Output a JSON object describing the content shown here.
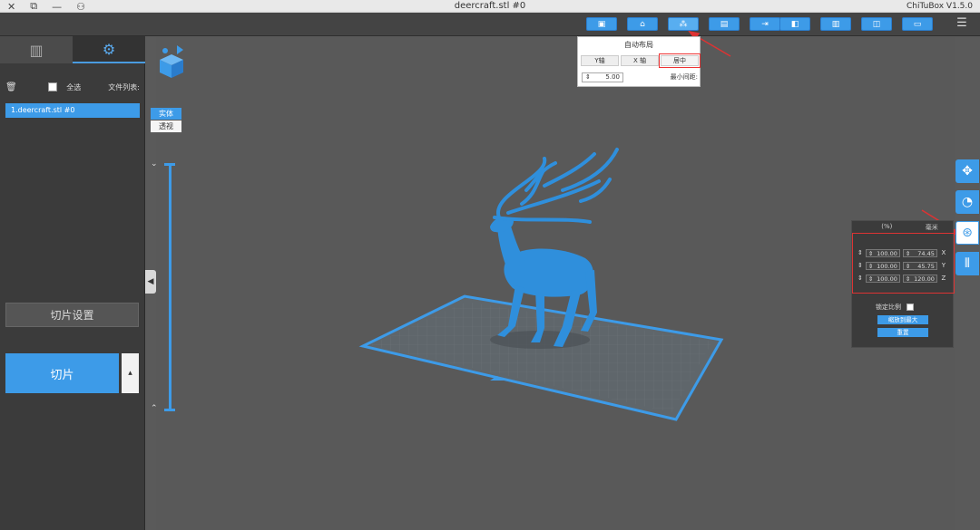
{
  "titlebar": {
    "file_title": "deercraft.stl #0",
    "app_name": "ChiTuBox V1.5.0",
    "close_glyph": "✕",
    "restore_glyph": "⧉",
    "minimize_glyph": "—",
    "user_glyph": "⚇"
  },
  "toolbar": {
    "menu_glyph": "☰",
    "buttons": [
      {
        "icon": "open-file-icon",
        "glyph": "▣"
      },
      {
        "icon": "home-icon",
        "glyph": "⌂"
      },
      {
        "icon": "auto-layout-icon",
        "glyph": "⁂"
      },
      {
        "icon": "copy-icon",
        "glyph": "▤"
      },
      {
        "icon": "export-icon",
        "glyph": "⇥"
      },
      {
        "icon": "view-icon",
        "glyph": "◧"
      },
      {
        "icon": "save-icon",
        "glyph": "▥"
      },
      {
        "icon": "model-icon",
        "glyph": "◫"
      },
      {
        "icon": "settings-icon",
        "glyph": "▭"
      }
    ]
  },
  "left_panel": {
    "file_list_label": "文件列表:",
    "select_all_label": "全选",
    "file_item": "1.deercraft.stl #0",
    "slice_settings_label": "切片设置",
    "slice_label": "切片",
    "slice_more_glyph": "▴",
    "collapse_glyph": "◀",
    "tab_settings_glyph": "⚙",
    "tab_platform_glyph": "▥"
  },
  "viewport": {
    "solid_label": "实体",
    "transparent_label": "透视",
    "slider_top_glyph": "⌄",
    "slider_bottom_glyph": "⌃"
  },
  "auto_layout_popup": {
    "title": "自动布局",
    "center_label": "居中",
    "x_axis_label": "X 轴",
    "y_axis_label": "Y轴",
    "min_spacing_label": "最小间距:",
    "min_spacing_value": "5.00",
    "spin_glyph": "⇕"
  },
  "right_tools": [
    {
      "name": "move",
      "glyph": "✥"
    },
    {
      "name": "rotate",
      "glyph": "◔"
    },
    {
      "name": "scale",
      "glyph": "⊛"
    },
    {
      "name": "mirror",
      "glyph": "⫴"
    }
  ],
  "scale_panel": {
    "col_mm": "毫米",
    "col_percent": "(%)",
    "rows": [
      {
        "axis": "X",
        "mm": "74.45",
        "pct": "100.00"
      },
      {
        "axis": "Y",
        "mm": "45.75",
        "pct": "100.00"
      },
      {
        "axis": "Z",
        "mm": "120.00",
        "pct": "100.00"
      }
    ],
    "spin_glyph": "⇕",
    "uniform_label": "锁定比例",
    "fit_label": "缩放到最大",
    "reset_label": "重置"
  },
  "colors": {
    "accent": "#3d9be8",
    "model": "#2f8fdc",
    "plate": "#5e6b74",
    "highlight_red": "#dd3333"
  }
}
